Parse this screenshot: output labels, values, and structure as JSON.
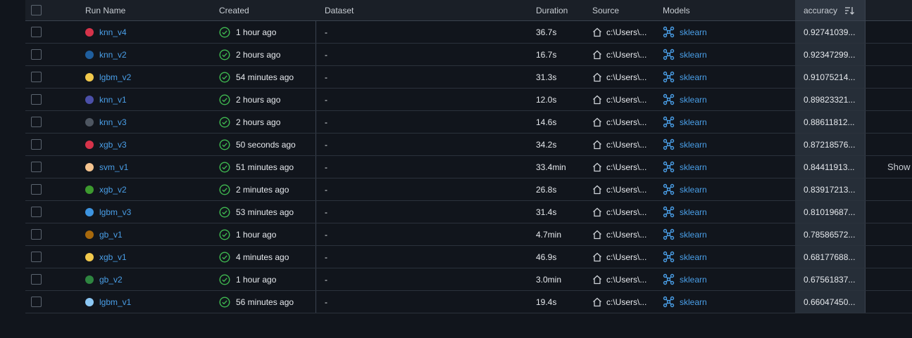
{
  "header": {
    "run_name": "Run Name",
    "created": "Created",
    "dataset": "Dataset",
    "duration": "Duration",
    "source": "Source",
    "models": "Models",
    "accuracy": "accuracy"
  },
  "rows": [
    {
      "name": "knn_v4",
      "color": "#d6334a",
      "created": "1 hour ago",
      "dataset": "-",
      "duration": "36.7s",
      "source": "c:\\Users\\...",
      "model": "sklearn",
      "accuracy": "0.92741039..."
    },
    {
      "name": "knn_v2",
      "color": "#1f5e9e",
      "created": "2 hours ago",
      "dataset": "-",
      "duration": "16.7s",
      "source": "c:\\Users\\...",
      "model": "sklearn",
      "accuracy": "0.92347299..."
    },
    {
      "name": "lgbm_v2",
      "color": "#f2c94c",
      "created": "54 minutes ago",
      "dataset": "-",
      "duration": "31.3s",
      "source": "c:\\Users\\...",
      "model": "sklearn",
      "accuracy": "0.91075214..."
    },
    {
      "name": "knn_v1",
      "color": "#4b4fa8",
      "created": "2 hours ago",
      "dataset": "-",
      "duration": "12.0s",
      "source": "c:\\Users\\...",
      "model": "sklearn",
      "accuracy": "0.89823321..."
    },
    {
      "name": "knn_v3",
      "color": "#4e5661",
      "created": "2 hours ago",
      "dataset": "-",
      "duration": "14.6s",
      "source": "c:\\Users\\...",
      "model": "sklearn",
      "accuracy": "0.88611812..."
    },
    {
      "name": "xgb_v3",
      "color": "#d6334a",
      "created": "50 seconds ago",
      "dataset": "-",
      "duration": "34.2s",
      "source": "c:\\Users\\...",
      "model": "sklearn",
      "accuracy": "0.87218576..."
    },
    {
      "name": "svm_v1",
      "color": "#f5c48f",
      "created": "51 minutes ago",
      "dataset": "-",
      "duration": "33.4min",
      "source": "c:\\Users\\...",
      "model": "sklearn",
      "accuracy": "0.84411913..."
    },
    {
      "name": "xgb_v2",
      "color": "#3d9a2f",
      "created": "2 minutes ago",
      "dataset": "-",
      "duration": "26.8s",
      "source": "c:\\Users\\...",
      "model": "sklearn",
      "accuracy": "0.83917213..."
    },
    {
      "name": "lgbm_v3",
      "color": "#3d94e0",
      "created": "53 minutes ago",
      "dataset": "-",
      "duration": "31.4s",
      "source": "c:\\Users\\...",
      "model": "sklearn",
      "accuracy": "0.81019687..."
    },
    {
      "name": "gb_v1",
      "color": "#a8690c",
      "created": "1 hour ago",
      "dataset": "-",
      "duration": "4.7min",
      "source": "c:\\Users\\...",
      "model": "sklearn",
      "accuracy": "0.78586572..."
    },
    {
      "name": "xgb_v1",
      "color": "#f2c94c",
      "created": "4 minutes ago",
      "dataset": "-",
      "duration": "46.9s",
      "source": "c:\\Users\\...",
      "model": "sklearn",
      "accuracy": "0.68177688..."
    },
    {
      "name": "gb_v2",
      "color": "#2e8540",
      "created": "1 hour ago",
      "dataset": "-",
      "duration": "3.0min",
      "source": "c:\\Users\\...",
      "model": "sklearn",
      "accuracy": "0.67561837..."
    },
    {
      "name": "lgbm_v1",
      "color": "#8cc8f5",
      "created": "56 minutes ago",
      "dataset": "-",
      "duration": "19.4s",
      "source": "c:\\Users\\...",
      "model": "sklearn",
      "accuracy": "0.66047450..."
    }
  ],
  "side_button": "Show"
}
